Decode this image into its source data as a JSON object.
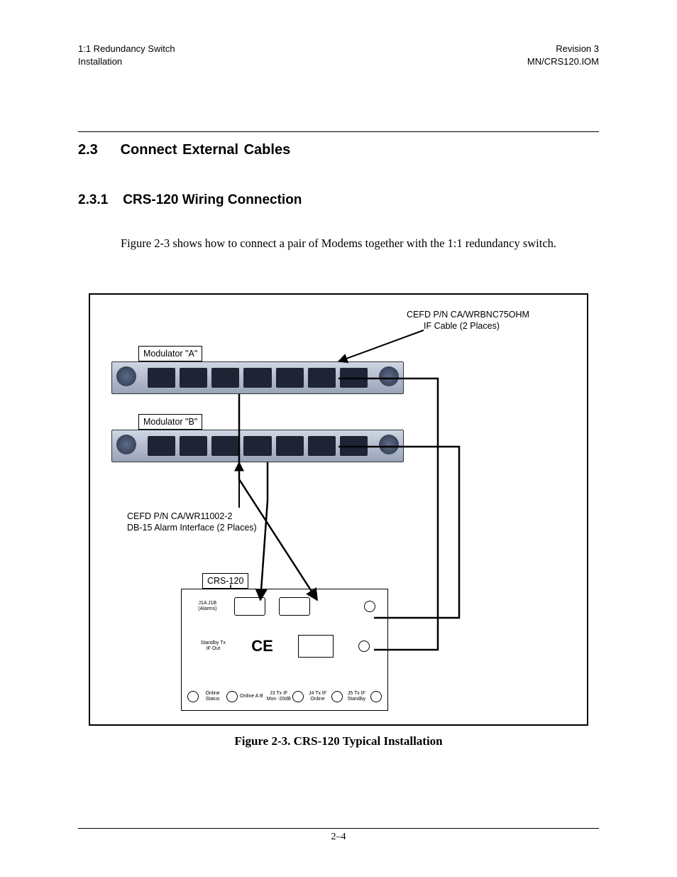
{
  "header": {
    "left_line1": "1:1 Redundancy Switch",
    "left_line2": "Installation",
    "right_line1": "Revision 3",
    "right_line2": "MN/CRS120.IOM"
  },
  "section": {
    "number": "2.3",
    "title": "Connect External Cables"
  },
  "subsection": {
    "number": "2.3.1",
    "title": "CRS-120 Wiring Connection"
  },
  "body_paragraph": "Figure 2-3 shows how to connect a pair of Modems together with the 1:1 redundancy switch.",
  "figure": {
    "callouts": {
      "if_cable_line1": "CEFD P/N CA/WRBNC75OHM",
      "if_cable_line2": "IF Cable   (2 Places)",
      "modulator_a": "Modulator \"A\"",
      "modulator_b": "Modulator \"B\"",
      "alarm_line1": "CEFD P/N CA/WR11002-2",
      "alarm_line2": "DB-15 Alarm Interface (2 Places)",
      "crs_label": "CRS-120"
    },
    "crs_labels": {
      "standby_out": "Standby Tx IF Out",
      "online_status": "Online Status",
      "online_ab": "Online A   B",
      "j3": "J3 Tx IF Mon -20dB",
      "j4": "J4 Tx IF Online",
      "j5": "J5 Tx IF Standby",
      "alarms": "J1A   J1B  (Alarms)",
      "ce": "CE"
    },
    "caption": "Figure 2-3.  CRS-120 Typical Installation"
  },
  "page_number": "2–4"
}
